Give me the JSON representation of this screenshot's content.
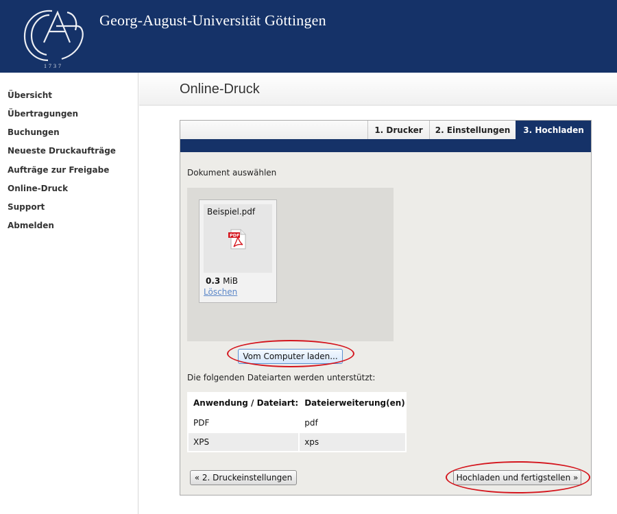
{
  "header": {
    "university": "Georg-August-Universität Göttingen",
    "logo_year": "1737"
  },
  "sidebar": {
    "items": [
      {
        "label": "Übersicht"
      },
      {
        "label": "Übertragungen"
      },
      {
        "label": "Buchungen"
      },
      {
        "label": "Neueste Druckaufträge"
      },
      {
        "label": "Aufträge zur Freigabe"
      },
      {
        "label": "Online-Druck"
      },
      {
        "label": "Support"
      },
      {
        "label": "Abmelden"
      }
    ]
  },
  "page": {
    "title": "Online-Druck"
  },
  "steps": [
    {
      "label": "1. Drucker"
    },
    {
      "label": "2. Einstellungen"
    },
    {
      "label": "3. Hochladen"
    }
  ],
  "upload": {
    "select_label": "Dokument auswählen",
    "file": {
      "name": "Beispiel.pdf",
      "size_value": "0.3",
      "size_unit": "MiB",
      "delete_label": "Löschen",
      "icon": "pdf-file-icon"
    },
    "load_button": "Vom Computer laden..."
  },
  "supported": {
    "label": "Die folgenden Dateiarten werden unterstützt:",
    "headers": [
      "Anwendung / Dateiart:",
      "Dateierweiterung(en)"
    ],
    "rows": [
      [
        "PDF",
        "pdf"
      ],
      [
        "XPS",
        "xps"
      ]
    ]
  },
  "footer": {
    "back_button": "« 2. Druckeinstellungen",
    "finish_button": "Hochladen und fertigstellen »"
  },
  "colors": {
    "brand": "#153268",
    "highlight": "#d4141c",
    "link": "#5b87c8"
  }
}
